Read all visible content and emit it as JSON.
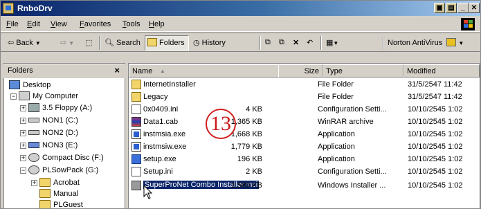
{
  "window": {
    "title": "RnboDrv"
  },
  "menu": [
    "File",
    "Edit",
    "View",
    "Favorites",
    "Tools",
    "Help"
  ],
  "toolbar": {
    "back": "Back",
    "search": "Search",
    "folders": "Folders",
    "history": "History",
    "antivirus": "Norton AntiVirus"
  },
  "folders_pane": {
    "title": "Folders",
    "close": "×",
    "items": [
      {
        "label": "Desktop"
      },
      {
        "label": "My Computer"
      },
      {
        "label": "3.5 Floppy (A:)"
      },
      {
        "label": "NON1 (C:)"
      },
      {
        "label": "NON2 (D:)"
      },
      {
        "label": "NON3 (E:)"
      },
      {
        "label": "Compact Disc (F:)"
      },
      {
        "label": "PLSowPack (G:)"
      },
      {
        "label": "Acrobat"
      },
      {
        "label": "Manual"
      },
      {
        "label": "PLGuest"
      }
    ]
  },
  "columns": {
    "name": "Name",
    "size": "Size",
    "type": "Type",
    "modified": "Modified"
  },
  "files": [
    {
      "name": "InternetInstaller",
      "size": "",
      "type": "File Folder",
      "modified": "31/5/2547 11:42",
      "icon": "folder-icon"
    },
    {
      "name": "Legacy",
      "size": "",
      "type": "File Folder",
      "modified": "31/5/2547 11:42",
      "icon": "folder-icon"
    },
    {
      "name": "0x0409.ini",
      "size": "4 KB",
      "type": "Configuration Setti...",
      "modified": "10/10/2545 1:02",
      "icon": "ini-file-icon"
    },
    {
      "name": "Data1.cab",
      "size": "1,365 KB",
      "type": "WinRAR archive",
      "modified": "10/10/2545 1:02",
      "icon": "cab-file-icon"
    },
    {
      "name": "instmsia.exe",
      "size": "1,668 KB",
      "type": "Application",
      "modified": "10/10/2545 1:02",
      "icon": "exe-file-icon"
    },
    {
      "name": "instmsiw.exe",
      "size": "1,779 KB",
      "type": "Application",
      "modified": "10/10/2545 1:02",
      "icon": "exe-file-icon"
    },
    {
      "name": "setup.exe",
      "size": "196 KB",
      "type": "Application",
      "modified": "10/10/2545 1:02",
      "icon": "setup-file-icon"
    },
    {
      "name": "Setup.ini",
      "size": "2 KB",
      "type": "Configuration Setti...",
      "modified": "10/10/2545 1:02",
      "icon": "ini-file-icon"
    },
    {
      "name": "SuperProNet Combo Installer.msi",
      "size": "1,580 KB",
      "type": "Windows Installer ...",
      "modified": "10/10/2545 1:02",
      "icon": "msi-file-icon"
    }
  ],
  "callout": "13"
}
